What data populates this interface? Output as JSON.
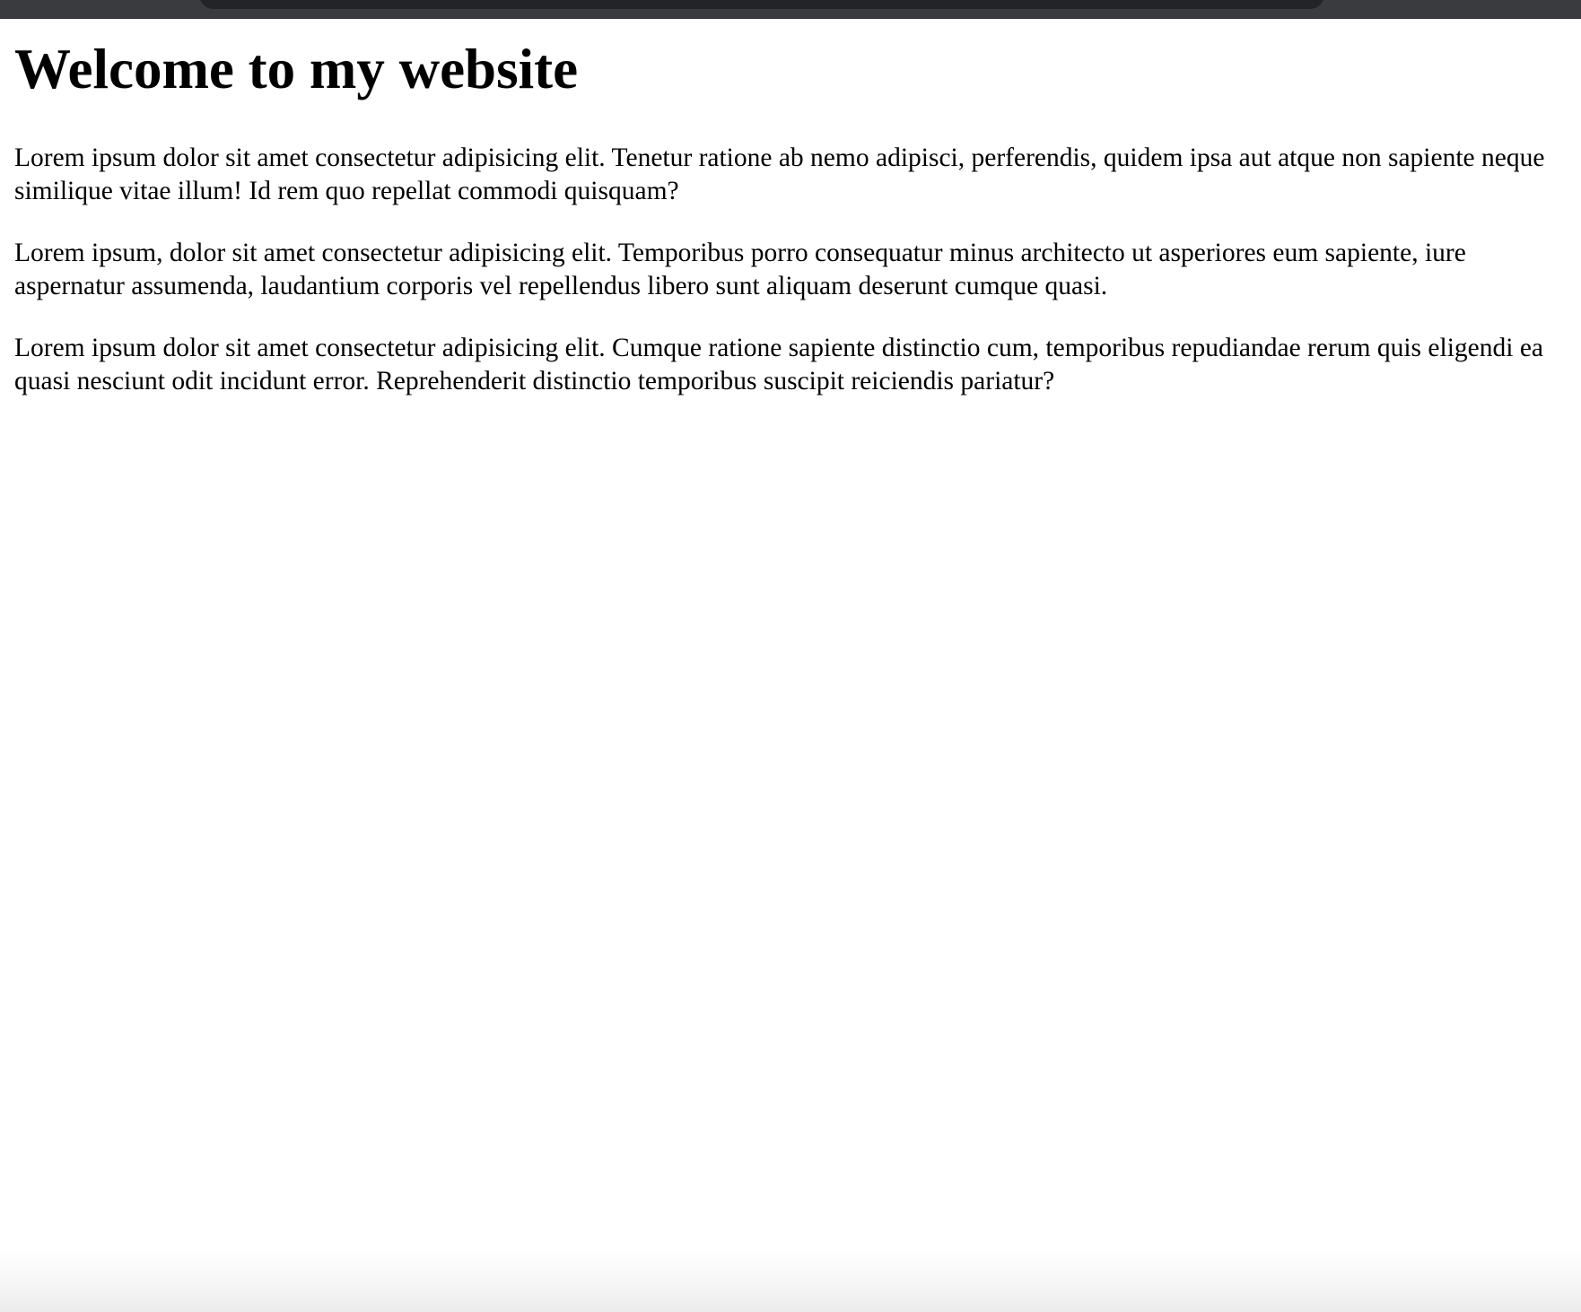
{
  "page": {
    "title": "Welcome to my website",
    "paragraphs": [
      "Lorem ipsum dolor sit amet consectetur adipisicing elit. Tenetur ratione ab nemo adipisci, perferendis, quidem ipsa aut atque non sapiente neque similique vitae illum! Id rem quo repellat commodi quisquam?",
      "Lorem ipsum, dolor sit amet consectetur adipisicing elit. Temporibus porro consequatur minus architecto ut asperiores eum sapiente, iure aspernatur assumenda, laudantium corporis vel repellendus libero sunt aliquam deserunt cumque quasi.",
      "Lorem ipsum dolor sit amet consectetur adipisicing elit. Cumque ratione sapiente distinctio cum, temporibus repudiandae rerum quis eligendi ea quasi nesciunt odit incidunt error. Reprehenderit distinctio temporibus suscipit reiciendis pariatur?"
    ]
  },
  "colors": {
    "background": "#ffffff",
    "text": "#000000",
    "chrome": "#3a3b3f",
    "address_bar": "#232428"
  }
}
